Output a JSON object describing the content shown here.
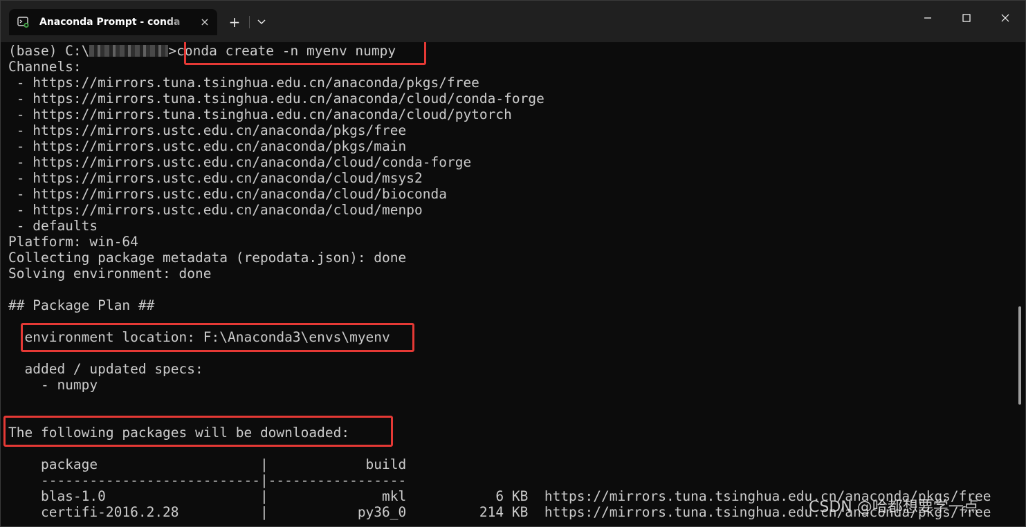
{
  "window": {
    "tab_title": "Anaconda Prompt - conda  create  -n  myenv  numpy",
    "tab_icon": "terminal-icon",
    "new_tab_label": "+",
    "tab_close_label": "×",
    "controls": [
      "minimize-icon",
      "maximize-icon",
      "close-icon"
    ]
  },
  "terminal": {
    "prompt_prefix": "(base) C:\\",
    "prompt_suffix": ">",
    "command": "conda create -n myenv numpy",
    "lines": [
      "Channels:",
      " - https://mirrors.tuna.tsinghua.edu.cn/anaconda/pkgs/free",
      " - https://mirrors.tuna.tsinghua.edu.cn/anaconda/cloud/conda-forge",
      " - https://mirrors.tuna.tsinghua.edu.cn/anaconda/cloud/pytorch",
      " - https://mirrors.ustc.edu.cn/anaconda/pkgs/free",
      " - https://mirrors.ustc.edu.cn/anaconda/pkgs/main",
      " - https://mirrors.ustc.edu.cn/anaconda/cloud/conda-forge",
      " - https://mirrors.ustc.edu.cn/anaconda/cloud/msys2",
      " - https://mirrors.ustc.edu.cn/anaconda/cloud/bioconda",
      " - https://mirrors.ustc.edu.cn/anaconda/cloud/menpo",
      " - defaults",
      "Platform: win-64",
      "Collecting package metadata (repodata.json): done",
      "Solving environment: done",
      "",
      "## Package Plan ##",
      "",
      "  environment location: F:\\Anaconda3\\envs\\myenv",
      "",
      "  added / updated specs:",
      "    - numpy",
      "",
      "",
      "The following packages will be downloaded:",
      "",
      "    package                    |            build",
      "    ---------------------------|-----------------",
      "    blas-1.0                   |              mkl           6 KB  https://mirrors.tuna.tsinghua.edu.cn/anaconda/pkgs/free",
      "    certifi-2016.2.28          |           py36_0         214 KB  https://mirrors.tuna.tsinghua.edu.cn/anaconda/pkgs/free"
    ]
  },
  "watermark": "CSDN @哈都想要学一点",
  "colors": {
    "background": "#0c0c0c",
    "text": "#cccccc",
    "titlebar": "#202020",
    "highlight": "#e53935"
  }
}
